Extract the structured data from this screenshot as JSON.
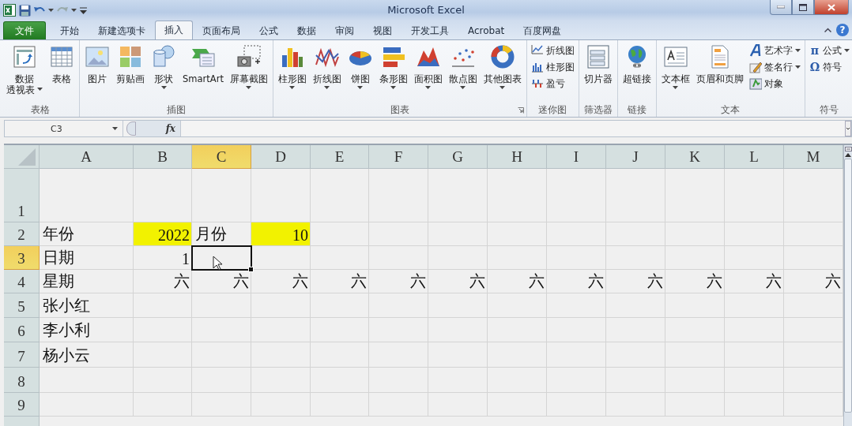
{
  "window": {
    "title": "Microsoft Excel",
    "help_label": "?"
  },
  "tabs": [
    {
      "label": "文件",
      "kind": "file",
      "selected": false
    },
    {
      "label": "开始",
      "kind": "tab",
      "selected": false
    },
    {
      "label": "新建选项卡",
      "kind": "tab",
      "selected": false
    },
    {
      "label": "插入",
      "kind": "tab",
      "selected": true
    },
    {
      "label": "页面布局",
      "kind": "tab",
      "selected": false
    },
    {
      "label": "公式",
      "kind": "tab",
      "selected": false
    },
    {
      "label": "数据",
      "kind": "tab",
      "selected": false
    },
    {
      "label": "审阅",
      "kind": "tab",
      "selected": false
    },
    {
      "label": "视图",
      "kind": "tab",
      "selected": false
    },
    {
      "label": "开发工具",
      "kind": "tab",
      "selected": false
    },
    {
      "label": "Acrobat",
      "kind": "tab",
      "selected": false
    },
    {
      "label": "百度网盘",
      "kind": "tab",
      "selected": false
    }
  ],
  "ribbon": [
    {
      "label": "表格",
      "items": [
        {
          "kind": "tall",
          "label": "数据透视表",
          "dropdown": true
        },
        {
          "kind": "large",
          "label": "表格"
        }
      ]
    },
    {
      "label": "插图",
      "items": [
        {
          "kind": "large",
          "label": "图片"
        },
        {
          "kind": "large",
          "label": "剪贴画"
        },
        {
          "kind": "large",
          "label": "形状",
          "dropdown": true
        },
        {
          "kind": "large",
          "label": "SmartArt"
        },
        {
          "kind": "large",
          "label": "屏幕截图",
          "dropdown": true
        }
      ]
    },
    {
      "label": "图表",
      "launcher": true,
      "items": [
        {
          "kind": "large",
          "label": "柱形图",
          "dropdown": true
        },
        {
          "kind": "large",
          "label": "折线图",
          "dropdown": true
        },
        {
          "kind": "large",
          "label": "饼图",
          "dropdown": true
        },
        {
          "kind": "large",
          "label": "条形图",
          "dropdown": true
        },
        {
          "kind": "large",
          "label": "面积图",
          "dropdown": true
        },
        {
          "kind": "large",
          "label": "散点图",
          "dropdown": true
        },
        {
          "kind": "large",
          "label": "其他图表",
          "dropdown": true
        }
      ]
    },
    {
      "label": "迷你图",
      "items": [
        {
          "kind": "small",
          "label": "折线图"
        },
        {
          "kind": "small",
          "label": "柱形图"
        },
        {
          "kind": "small",
          "label": "盈亏"
        }
      ]
    },
    {
      "label": "筛选器",
      "items": [
        {
          "kind": "large",
          "label": "切片器"
        }
      ]
    },
    {
      "label": "链接",
      "items": [
        {
          "kind": "large",
          "label": "超链接"
        }
      ]
    },
    {
      "label": "文本",
      "items": [
        {
          "kind": "large",
          "label": "文本框",
          "dropdown": true
        },
        {
          "kind": "large",
          "label": "页眉和页脚"
        },
        {
          "kind": "small",
          "label": "艺术字",
          "dropdown": true
        },
        {
          "kind": "small",
          "label": "签名行",
          "dropdown": true
        },
        {
          "kind": "small",
          "label": "对象"
        }
      ]
    },
    {
      "label": "符号",
      "items": [
        {
          "kind": "glyph",
          "glyph": "π",
          "label": "公式",
          "dropdown": true
        },
        {
          "kind": "glyph",
          "glyph": "Ω",
          "label": "符号"
        }
      ]
    }
  ],
  "formula_bar": {
    "name_box": "C3",
    "function_label": "fx"
  },
  "sheet": {
    "columns": [
      {
        "label": "A",
        "selected": false
      },
      {
        "label": "B",
        "selected": false
      },
      {
        "label": "C",
        "selected": true
      },
      {
        "label": "D",
        "selected": false
      },
      {
        "label": "E",
        "selected": false
      },
      {
        "label": "F",
        "selected": false
      },
      {
        "label": "G",
        "selected": false
      },
      {
        "label": "H",
        "selected": false
      },
      {
        "label": "I",
        "selected": false
      },
      {
        "label": "J",
        "selected": false
      },
      {
        "label": "K",
        "selected": false
      },
      {
        "label": "L",
        "selected": false
      },
      {
        "label": "M",
        "selected": false
      }
    ],
    "rows": [
      {
        "number": "1",
        "selected": false,
        "cells": []
      },
      {
        "number": "2",
        "selected": false,
        "cells": [
          {
            "text": "年份",
            "kind": "text",
            "highlighted": false,
            "active": false
          },
          {
            "text": "2022",
            "kind": "number",
            "highlighted": true,
            "active": false
          },
          {
            "text": "月份",
            "kind": "text",
            "highlighted": false,
            "active": false
          },
          {
            "text": "10",
            "kind": "number",
            "highlighted": true,
            "active": false
          }
        ]
      },
      {
        "number": "3",
        "selected": true,
        "cells": [
          {
            "text": "日期",
            "kind": "text",
            "highlighted": false,
            "active": false
          },
          {
            "text": "1",
            "kind": "number",
            "highlighted": false,
            "active": false
          },
          {
            "kind": "text",
            "highlighted": false,
            "active": true
          }
        ]
      },
      {
        "number": "4",
        "selected": false,
        "cells": [
          {
            "text": "星期",
            "kind": "text",
            "highlighted": false,
            "active": false
          },
          {
            "text": "六",
            "kind": "number",
            "highlighted": false,
            "active": false
          },
          {
            "text": "六",
            "kind": "number",
            "highlighted": false,
            "active": false
          },
          {
            "text": "六",
            "kind": "number",
            "highlighted": false,
            "active": false
          },
          {
            "text": "六",
            "kind": "number",
            "highlighted": false,
            "active": false
          },
          {
            "text": "六",
            "kind": "number",
            "highlighted": false,
            "active": false
          },
          {
            "text": "六",
            "kind": "number",
            "highlighted": false,
            "active": false
          },
          {
            "text": "六",
            "kind": "number",
            "highlighted": false,
            "active": false
          },
          {
            "text": "六",
            "kind": "number",
            "highlighted": false,
            "active": false
          },
          {
            "text": "六",
            "kind": "number",
            "highlighted": false,
            "active": false
          },
          {
            "text": "六",
            "kind": "number",
            "highlighted": false,
            "active": false
          },
          {
            "text": "六",
            "kind": "number",
            "highlighted": false,
            "active": false
          },
          {
            "text": "六",
            "kind": "number",
            "highlighted": false,
            "active": false
          }
        ]
      },
      {
        "number": "5",
        "selected": false,
        "cells": [
          {
            "text": "张小红",
            "kind": "text",
            "highlighted": false,
            "active": false
          }
        ]
      },
      {
        "number": "6",
        "selected": false,
        "cells": [
          {
            "text": "李小利",
            "kind": "text",
            "highlighted": false,
            "active": false
          }
        ]
      },
      {
        "number": "7",
        "selected": false,
        "cells": [
          {
            "text": "杨小云",
            "kind": "text",
            "highlighted": false,
            "active": false
          }
        ]
      },
      {
        "number": "8",
        "selected": false,
        "cells": []
      },
      {
        "number": "9",
        "selected": false,
        "cells": []
      }
    ]
  }
}
